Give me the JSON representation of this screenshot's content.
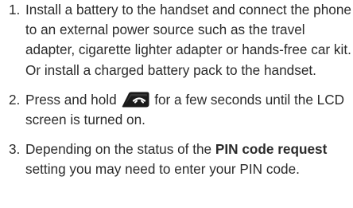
{
  "steps": [
    {
      "number": "1.",
      "text": "Install a battery to the handset and connect the phone to an external power source such as the travel adapter, cigarette lighter adapter or hands-free car kit. Or install a charged battery pack to the handset."
    },
    {
      "number": "2.",
      "text_before": "Press and hold",
      "icon": "end-power-key-icon",
      "text_after": "for a few seconds until the LCD screen is turned on."
    },
    {
      "number": "3.",
      "text_before": "Depending on the status of the",
      "bold": "PIN code request",
      "text_after": "setting you may need to enter your PIN code."
    }
  ]
}
